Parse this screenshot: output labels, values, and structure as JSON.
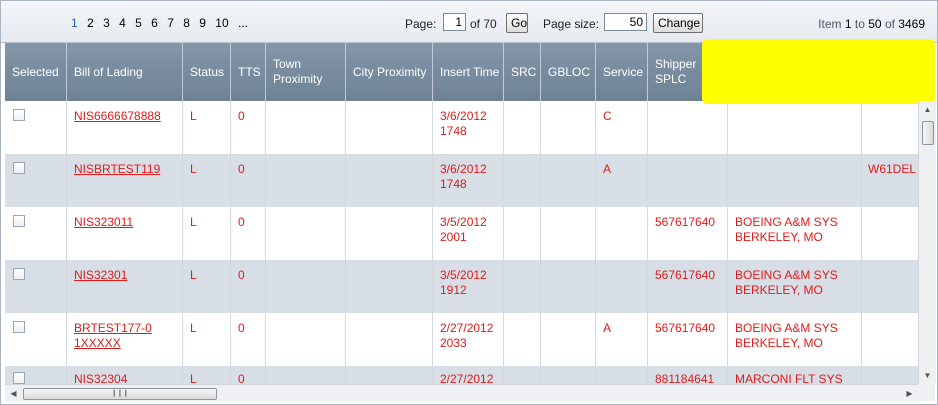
{
  "pager": {
    "pages": [
      "1",
      "2",
      "3",
      "4",
      "5",
      "6",
      "7",
      "8",
      "9",
      "10",
      "..."
    ],
    "page_label": "Page:",
    "page_value": "1",
    "of_text": "of 70",
    "go_label": "Go",
    "size_label": "Page size:",
    "size_value": "50",
    "change_label": "Change",
    "item_prefix": "Item",
    "item_from": "1",
    "item_to_word": "to",
    "item_to": "50",
    "item_of_word": "of",
    "item_total": "3469"
  },
  "columns": [
    "Selected",
    "Bill of Lading",
    "Status",
    "TTS",
    "Town Proximity",
    "City Proximity",
    "Insert Time",
    "SRC",
    "GBLOC",
    "Service",
    "Shipper SPLC"
  ],
  "rows": [
    {
      "bol": "NIS6666678888",
      "status": "L",
      "tts": "0",
      "time": "3/6/2012 1748",
      "service": "C",
      "splc": "",
      "name": "",
      "extra": ""
    },
    {
      "bol": "NISBRTEST119",
      "status": "L",
      "tts": "0",
      "time": "3/6/2012 1748",
      "service": "A",
      "splc": "",
      "name": "",
      "extra": "W61DEL"
    },
    {
      "bol": "NIS323011",
      "status": "L",
      "tts": "0",
      "time": "3/5/2012 2001",
      "service": "",
      "splc": "567617640",
      "name": "BOEING A&M SYS BERKELEY, MO",
      "extra": ""
    },
    {
      "bol": "NIS32301",
      "status": "L",
      "tts": "0",
      "time": "3/5/2012 1912",
      "service": "",
      "splc": "567617640",
      "name": "BOEING A&M SYS BERKELEY, MO",
      "extra": ""
    },
    {
      "bol": "BRTEST177-01XXXXX",
      "status": "L",
      "tts": "0",
      "time": "2/27/2012 2033",
      "service": "A",
      "splc": "567617640",
      "name": "BOEING A&M SYS BERKELEY, MO",
      "extra": ""
    },
    {
      "bol": "NIS32304",
      "status": "L",
      "tts": "0",
      "time": "2/27/2012",
      "service": "",
      "splc": "881184641",
      "name": "MARCONI FLT SYS",
      "extra": ""
    }
  ],
  "colors": {
    "header": "#7a8ca0",
    "alt_row": "#d7dee6",
    "text": "#e01b1b",
    "highlight": "#ffff00"
  },
  "icons": {
    "scroll_up": "triangle-up",
    "scroll_down": "triangle-down",
    "scroll_left": "triangle-left",
    "scroll_right": "triangle-right",
    "thumb_grip": "grip-lines"
  }
}
